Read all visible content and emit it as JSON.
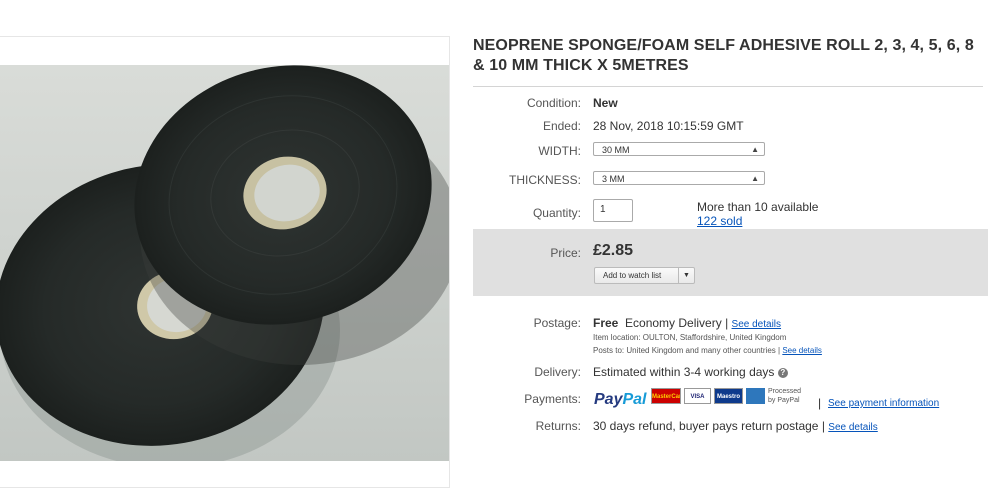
{
  "listing": {
    "title": "NEOPRENE SPONGE/FOAM SELF ADHESIVE ROLL 2, 3, 4, 5, 6, 8 & 10 MM THICK X 5METRES"
  },
  "details": {
    "condition_label": "Condition:",
    "condition_value": "New",
    "ended_label": "Ended:",
    "ended_value": "28 Nov, 2018  10:15:59 GMT",
    "width_label": "WIDTH:",
    "width_value": "30 MM",
    "thickness_label": "THICKNESS:",
    "thickness_value": "3 MM",
    "quantity_label": "Quantity:",
    "quantity_value": "1",
    "availability": "More than 10 available",
    "sold": "122 sold"
  },
  "price": {
    "label": "Price:",
    "value": "£2.85",
    "watch_label": "Add to watch list"
  },
  "postage": {
    "label": "Postage:",
    "free": "Free",
    "service": "Economy Delivery",
    "sep": "|",
    "see_details": "See details",
    "item_location": "Item location:  OULTON, Staffordshire, United Kingdom",
    "posts_to": "Posts to:  United Kingdom and many other countries |",
    "posts_see_details": "See details"
  },
  "delivery": {
    "label": "Delivery:",
    "value": "Estimated within 3-4 working days",
    "help_icon": "?"
  },
  "payments": {
    "label": "Payments:",
    "paypal_pay": "Pay",
    "paypal_pal": "Pal",
    "card_mastercard": "MasterCard",
    "card_visa": "VISA",
    "card_maestro": "Maestro",
    "processed": "Processed",
    "by_paypal": "by PayPal",
    "sep": "|",
    "see_payment": "See payment information"
  },
  "returns": {
    "label": "Returns:",
    "value": "30 days refund, buyer pays return postage",
    "sep": "|",
    "see_details": "See details"
  },
  "colors": {
    "link": "#0654ba",
    "price_box": "#e0e0e0",
    "paypal_dark": "#253b80",
    "paypal_light": "#179bd7"
  }
}
